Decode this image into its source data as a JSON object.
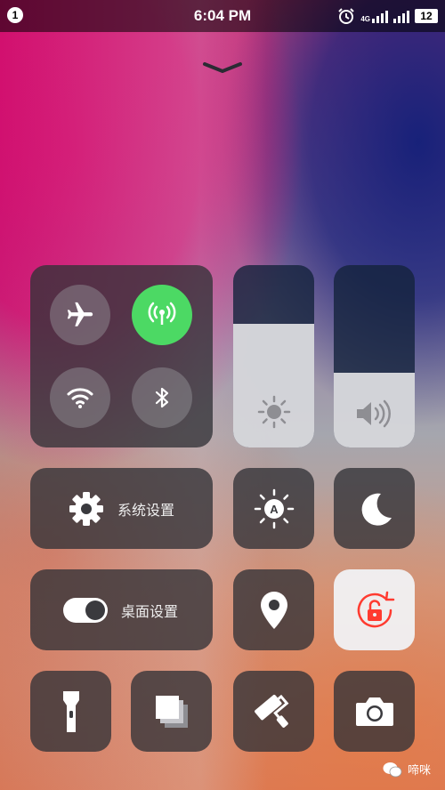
{
  "status_bar": {
    "notification_count": "1",
    "time": "6:04 PM",
    "network_type": "4G",
    "battery": "12",
    "icons": [
      "alarm-icon",
      "signal-icon",
      "signal-icon",
      "battery-icon"
    ]
  },
  "collapse_handle": {
    "icon": "chevron-down-icon"
  },
  "connectivity": {
    "airplane": {
      "icon": "airplane-icon",
      "active": false
    },
    "cellular": {
      "icon": "cellular-antenna-icon",
      "active": true,
      "color": "#4cd964"
    },
    "wifi": {
      "icon": "wifi-icon",
      "active": false
    },
    "bluetooth": {
      "icon": "bluetooth-icon",
      "active": false
    }
  },
  "brightness": {
    "icon": "sun-icon",
    "level": 0.68
  },
  "volume": {
    "icon": "speaker-icon",
    "level": 0.41
  },
  "system_settings": {
    "label": "系统设置",
    "icon": "gear-icon"
  },
  "auto_brightness": {
    "icon": "auto-brightness-icon",
    "letter": "A"
  },
  "do_not_disturb": {
    "icon": "moon-icon"
  },
  "desktop_settings": {
    "label": "桌面设置",
    "icon": "toggle-icon"
  },
  "location": {
    "icon": "location-pin-icon"
  },
  "rotation_lock": {
    "icon": "rotation-lock-icon",
    "active": true,
    "color": "#ff3b30"
  },
  "flashlight": {
    "icon": "flashlight-icon"
  },
  "screenshot": {
    "icon": "screenshot-icon"
  },
  "cleaner": {
    "icon": "paint-roller-icon"
  },
  "camera": {
    "icon": "camera-icon"
  },
  "watermark": {
    "text": "啼咪",
    "icon": "wechat-icon"
  }
}
